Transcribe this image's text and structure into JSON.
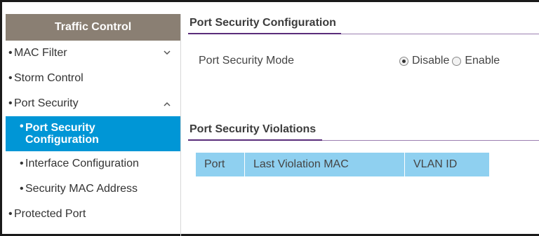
{
  "sidebar": {
    "header": "Traffic Control",
    "items": [
      {
        "label": "MAC Filter",
        "chevron": "down"
      },
      {
        "label": "Storm Control"
      },
      {
        "label": "Port Security",
        "chevron": "up"
      },
      {
        "label_line1": "Port Security",
        "label_line2": "Configuration",
        "active": true
      },
      {
        "label": "Interface Configuration"
      },
      {
        "label": "Security MAC Address"
      },
      {
        "label": "Protected Port"
      }
    ]
  },
  "config": {
    "title": "Port Security Configuration",
    "mode_label": "Port Security Mode",
    "options": [
      "Disable",
      "Enable"
    ],
    "selected": "Disable"
  },
  "violations": {
    "title": "Port Security Violations",
    "columns": [
      "Port",
      "Last Violation MAC",
      "VLAN ID"
    ]
  },
  "colors": {
    "sidebar_header": "#8a7f73",
    "active_item": "#0096d6",
    "table_header": "#8fd0f0",
    "title_underline": "#5a2d7a"
  }
}
